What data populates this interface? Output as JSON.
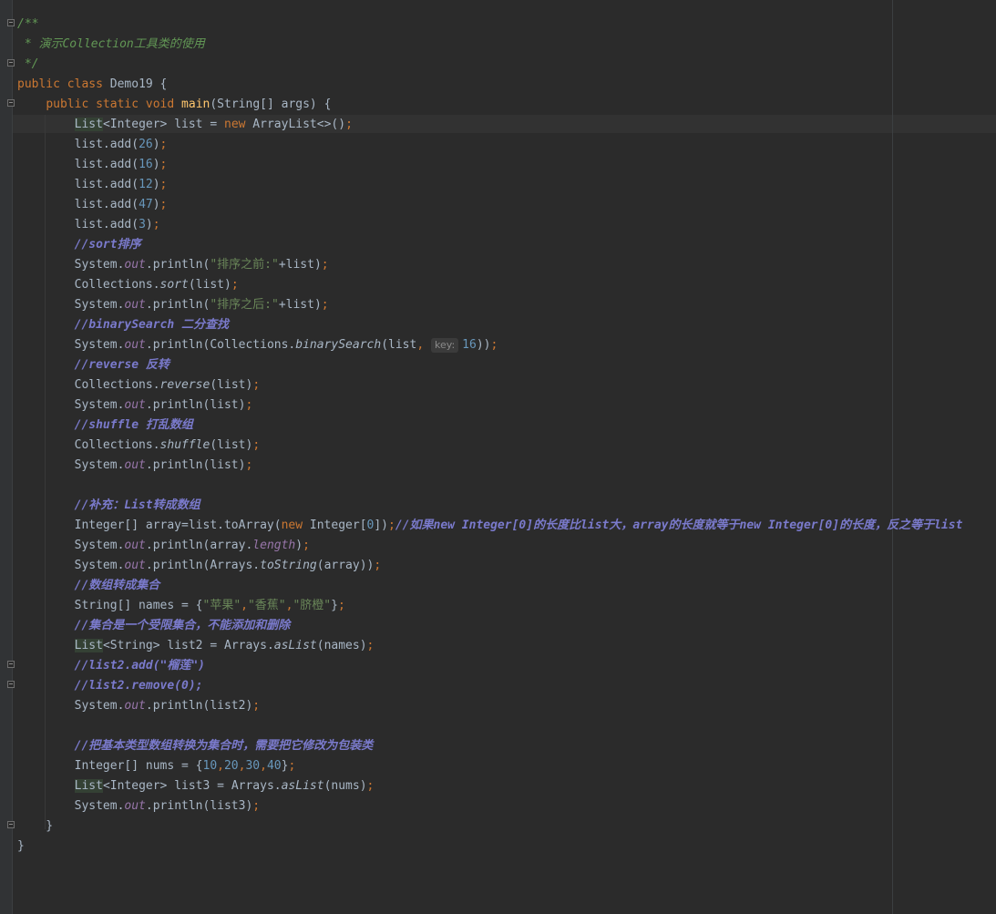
{
  "editor": {
    "lines": [
      "/**",
      " * 演示Collection工具类的使用",
      " */",
      "public class Demo19 {",
      "    public static void main(String[] args) {",
      "        List<Integer> list = new ArrayList<>();",
      "        list.add(26);",
      "        list.add(16);",
      "        list.add(12);",
      "        list.add(47);",
      "        list.add(3);",
      "        //sort排序",
      "        System.out.println(\"排序之前:\"+list);",
      "        Collections.sort(list);",
      "        System.out.println(\"排序之后:\"+list);",
      "        //binarySearch 二分查找",
      "        System.out.println(Collections.binarySearch(list,  key: 16));",
      "        //reverse 反转",
      "        Collections.reverse(list);",
      "        System.out.println(list);",
      "        //shuffle 打乱数组",
      "        Collections.shuffle(list);",
      "        System.out.println(list);",
      "",
      "        //补充：List转成数组",
      "        Integer[] array=list.toArray(new Integer[0]);//如果new Integer[0]的长度比list大，array的长度就等于new Integer[0]的长度，反之等于list",
      "        System.out.println(array.length);",
      "        System.out.println(Arrays.toString(array));",
      "        //数组转成集合",
      "        String[] names = {\"苹果\",\"香蕉\",\"脐橙\"};",
      "        //集合是一个受限集合，不能添加和删除",
      "        List<String> list2 = Arrays.asList(names);",
      "        //list2.add(\"榴莲\")",
      "        //list2.remove(0);",
      "        System.out.println(list2);",
      "",
      "        //把基本类型数组转换为集合时，需要把它修改为包装类",
      "        Integer[] nums = {10,20,30,40};",
      "        List<Integer> list3 = Arrays.asList(nums);",
      "        System.out.println(list3);",
      "    }",
      "}"
    ]
  }
}
